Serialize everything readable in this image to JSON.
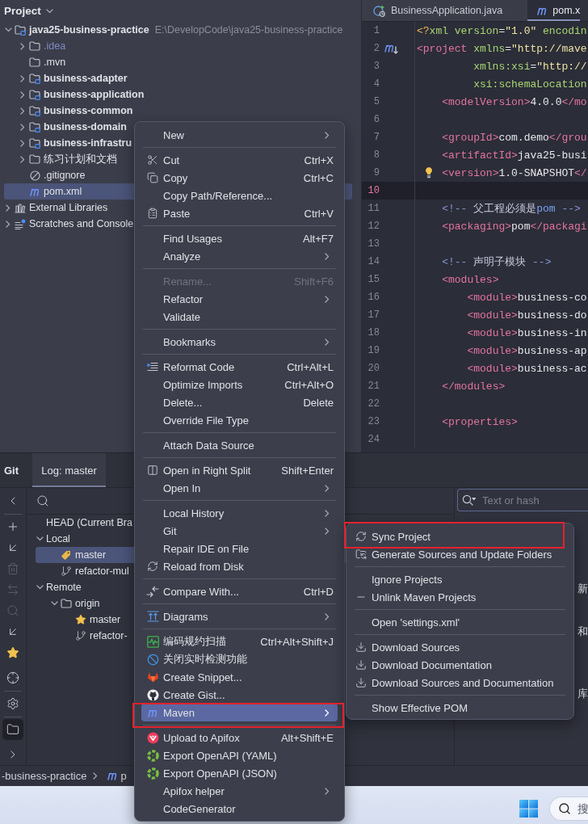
{
  "project_panel": {
    "title": "Project",
    "tree": [
      {
        "label": "java25-business-practice",
        "path": "E:\\DevelopCode\\java25-business-practice",
        "kind": "module",
        "expanded": true,
        "selected": false,
        "children": [
          {
            "label": ".idea",
            "kind": "excluded-folder",
            "expanded": false,
            "selected": false
          },
          {
            "label": ".mvn",
            "kind": "folder",
            "selected": false
          },
          {
            "label": "business-adapter",
            "kind": "module",
            "expanded": false,
            "selected": false
          },
          {
            "label": "business-application",
            "kind": "module",
            "expanded": false,
            "selected": false
          },
          {
            "label": "business-common",
            "kind": "module",
            "expanded": false,
            "selected": false
          },
          {
            "label": "business-domain",
            "kind": "module",
            "expanded": false,
            "selected": false
          },
          {
            "label": "business-infrastru",
            "kind": "module",
            "expanded": false,
            "selected": false
          },
          {
            "label": "练习计划和文档",
            "kind": "folder",
            "expanded": false,
            "selected": false
          },
          {
            "label": ".gitignore",
            "kind": "ignore-file",
            "selected": false
          },
          {
            "label": "pom.xml",
            "kind": "maven-file",
            "selected": true
          }
        ]
      },
      {
        "label": "External Libraries",
        "kind": "libraries",
        "expanded": false,
        "selected": false
      },
      {
        "label": "Scratches and Console",
        "kind": "scratches",
        "expanded": false,
        "selected": false
      }
    ]
  },
  "editor": {
    "tabs": [
      {
        "label": "BusinessApplication.java",
        "kind": "java",
        "selected": false
      },
      {
        "label": "pom.x",
        "kind": "maven",
        "selected": true
      }
    ],
    "lines": [
      {
        "number": "1",
        "current": false,
        "tokens": [
          {
            "kind": "pi",
            "text": "<?"
          },
          {
            "kind": "attr",
            "text": "xml version"
          },
          {
            "kind": "punct",
            "text": "="
          },
          {
            "kind": "value",
            "text": "\"1.0\""
          },
          {
            "kind": "attr",
            "text": " encodin"
          }
        ]
      },
      {
        "number": "2",
        "current": false,
        "tokens": [
          {
            "kind": "tag",
            "text": "<project"
          },
          {
            "kind": "attr",
            "text": " xmlns"
          },
          {
            "kind": "punct",
            "text": "="
          },
          {
            "kind": "value",
            "text": "\"http://mave"
          }
        ]
      },
      {
        "number": "3",
        "current": false,
        "tokens": [
          {
            "kind": "attr",
            "text": "         xmlns:xsi"
          },
          {
            "kind": "punct",
            "text": "="
          },
          {
            "kind": "value",
            "text": "\"http://"
          }
        ]
      },
      {
        "number": "4",
        "current": false,
        "tokens": [
          {
            "kind": "attr",
            "text": "         xsi:schemaLocation"
          }
        ]
      },
      {
        "number": "5",
        "current": false,
        "tokens": [
          {
            "kind": "tag",
            "text": "    <modelVersion>"
          },
          {
            "kind": "text",
            "text": "4.0.0"
          },
          {
            "kind": "tag",
            "text": "</mo"
          }
        ]
      },
      {
        "number": "6",
        "current": false
      },
      {
        "number": "7",
        "current": false,
        "tokens": [
          {
            "kind": "tag",
            "text": "    <groupId>"
          },
          {
            "kind": "text",
            "text": "com.demo"
          },
          {
            "kind": "tag",
            "text": "</grou"
          }
        ]
      },
      {
        "number": "8",
        "current": false,
        "tokens": [
          {
            "kind": "tag",
            "text": "    <artifactId>"
          },
          {
            "kind": "text",
            "text": "java25-busi"
          }
        ]
      },
      {
        "number": "9",
        "current": false,
        "tokens": [
          {
            "kind": "tag",
            "text": "    <version>"
          },
          {
            "kind": "text",
            "text": "1.0-SNAPSHOT"
          },
          {
            "kind": "tag",
            "text": "</"
          }
        ]
      },
      {
        "number": "10",
        "current": true
      },
      {
        "number": "11",
        "current": false,
        "tokens": [
          {
            "kind": "comment",
            "text": "    <!-- "
          },
          {
            "kind": "comment-text",
            "text": "父工程必须是"
          },
          {
            "kind": "comment-keyword",
            "text": "pom"
          },
          {
            "kind": "comment",
            "text": " -->"
          }
        ]
      },
      {
        "number": "12",
        "current": false,
        "tokens": [
          {
            "kind": "tag",
            "text": "    <packaging>"
          },
          {
            "kind": "text",
            "text": "pom"
          },
          {
            "kind": "tag",
            "text": "</packagi"
          }
        ]
      },
      {
        "number": "13",
        "current": false
      },
      {
        "number": "14",
        "current": false,
        "tokens": [
          {
            "kind": "comment",
            "text": "    <!-- "
          },
          {
            "kind": "comment-text",
            "text": "声明子模块"
          },
          {
            "kind": "comment",
            "text": " -->"
          }
        ]
      },
      {
        "number": "15",
        "current": false,
        "tokens": [
          {
            "kind": "tag",
            "text": "    <modules>"
          }
        ]
      },
      {
        "number": "16",
        "current": false,
        "tokens": [
          {
            "kind": "tag",
            "text": "        <module>"
          },
          {
            "kind": "text",
            "text": "business-co"
          }
        ]
      },
      {
        "number": "17",
        "current": false,
        "tokens": [
          {
            "kind": "tag",
            "text": "        <module>"
          },
          {
            "kind": "text",
            "text": "business-do"
          }
        ]
      },
      {
        "number": "18",
        "current": false,
        "tokens": [
          {
            "kind": "tag",
            "text": "        <module>"
          },
          {
            "kind": "text",
            "text": "business-in"
          }
        ]
      },
      {
        "number": "19",
        "current": false,
        "tokens": [
          {
            "kind": "tag",
            "text": "        <module>"
          },
          {
            "kind": "text",
            "text": "business-ap"
          }
        ]
      },
      {
        "number": "20",
        "current": false,
        "tokens": [
          {
            "kind": "tag",
            "text": "        <module>"
          },
          {
            "kind": "text",
            "text": "business-ac"
          }
        ]
      },
      {
        "number": "21",
        "current": false,
        "tokens": [
          {
            "kind": "tag",
            "text": "    </modules>"
          }
        ]
      },
      {
        "number": "22",
        "current": false
      },
      {
        "number": "23",
        "current": false,
        "tokens": [
          {
            "kind": "tag",
            "text": "    <properties>"
          }
        ]
      },
      {
        "number": "24",
        "current": false
      }
    ]
  },
  "git_panel": {
    "title": "Git",
    "tabs": [
      {
        "label": "Log: master",
        "selected": true
      }
    ],
    "toolbar": [
      [
        {
          "kind": "collapse",
          "disabled": false,
          "selected": false
        }
      ],
      [
        {
          "kind": "add",
          "disabled": false,
          "selected": false
        },
        {
          "kind": "checkout",
          "disabled": false,
          "selected": false
        },
        {
          "kind": "delete",
          "disabled": true,
          "selected": false
        },
        {
          "kind": "compare",
          "disabled": true,
          "selected": false
        },
        {
          "kind": "search",
          "disabled": true,
          "selected": false
        },
        {
          "kind": "update",
          "disabled": false,
          "selected": false
        },
        {
          "kind": "favorite",
          "disabled": false,
          "selected": false
        },
        {
          "kind": "locate",
          "disabled": false,
          "selected": false
        }
      ],
      [
        {
          "kind": "settings",
          "disabled": false,
          "selected": false
        }
      ],
      [
        {
          "kind": "branches",
          "disabled": false,
          "selected": true
        },
        {
          "kind": "expand",
          "disabled": false,
          "selected": false
        }
      ]
    ],
    "branches": [
      {
        "label": "HEAD (Current Bra",
        "selected": false
      },
      {
        "label": "Local",
        "expanded": true,
        "selected": false,
        "children": [
          {
            "label": "master",
            "kind": "current-branch",
            "selected": true
          },
          {
            "label": "refactor-mul",
            "kind": "branch",
            "selected": false
          }
        ]
      },
      {
        "label": "Remote",
        "expanded": true,
        "selected": false,
        "children": [
          {
            "label": "origin",
            "kind": "remote",
            "expanded": true,
            "selected": false,
            "children": [
              {
                "label": "master",
                "kind": "favorite-branch",
                "selected": false
              },
              {
                "label": "refactor-",
                "kind": "branch",
                "selected": false
              }
            ]
          }
        ]
      }
    ],
    "log_search": {
      "placeholder": "Text or hash"
    },
    "log_fragments": [
      "新",
      "和",
      "库"
    ]
  },
  "context_menu": {
    "sections": [
      [
        {
          "label": "New",
          "submenu": true,
          "disabled": false,
          "selected": false
        }
      ],
      [
        {
          "label": "Cut",
          "shortcut": "Ctrl+X",
          "submenu": false,
          "disabled": false,
          "selected": false
        },
        {
          "label": "Copy",
          "shortcut": "Ctrl+C",
          "submenu": false,
          "disabled": false,
          "selected": false
        },
        {
          "label": "Copy Path/Reference...",
          "submenu": false,
          "disabled": false,
          "selected": false
        },
        {
          "label": "Paste",
          "shortcut": "Ctrl+V",
          "submenu": false,
          "disabled": false,
          "selected": false
        }
      ],
      [
        {
          "label": "Find Usages",
          "shortcut": "Alt+F7",
          "submenu": false,
          "disabled": false,
          "selected": false
        },
        {
          "label": "Analyze",
          "submenu": true,
          "disabled": false,
          "selected": false
        }
      ],
      [
        {
          "label": "Rename...",
          "shortcut": "Shift+F6",
          "submenu": false,
          "disabled": true,
          "selected": false
        },
        {
          "label": "Refactor",
          "submenu": true,
          "disabled": false,
          "selected": false
        },
        {
          "label": "Validate",
          "submenu": false,
          "disabled": false,
          "selected": false
        }
      ],
      [
        {
          "label": "Bookmarks",
          "submenu": true,
          "disabled": false,
          "selected": false
        }
      ],
      [
        {
          "label": "Reformat Code",
          "shortcut": "Ctrl+Alt+L",
          "submenu": false,
          "disabled": false,
          "selected": false
        },
        {
          "label": "Optimize Imports",
          "shortcut": "Ctrl+Alt+O",
          "submenu": false,
          "disabled": false,
          "selected": false
        },
        {
          "label": "Delete...",
          "shortcut": "Delete",
          "submenu": false,
          "disabled": false,
          "selected": false
        },
        {
          "label": "Override File Type",
          "submenu": false,
          "disabled": false,
          "selected": false
        }
      ],
      [
        {
          "label": "Attach Data Source",
          "submenu": false,
          "disabled": false,
          "selected": false
        }
      ],
      [
        {
          "label": "Open in Right Split",
          "shortcut": "Shift+Enter",
          "submenu": false,
          "disabled": false,
          "selected": false
        },
        {
          "label": "Open In",
          "submenu": true,
          "disabled": false,
          "selected": false
        }
      ],
      [
        {
          "label": "Local History",
          "submenu": true,
          "disabled": false,
          "selected": false
        },
        {
          "label": "Git",
          "submenu": true,
          "disabled": false,
          "selected": false
        },
        {
          "label": "Repair IDE on File",
          "submenu": false,
          "disabled": false,
          "selected": false
        },
        {
          "label": "Reload from Disk",
          "submenu": false,
          "disabled": false,
          "selected": false
        }
      ],
      [
        {
          "label": "Compare With...",
          "shortcut": "Ctrl+D",
          "submenu": false,
          "disabled": false,
          "selected": false
        }
      ],
      [
        {
          "label": "Diagrams",
          "submenu": true,
          "disabled": false,
          "selected": false
        }
      ],
      [
        {
          "label": "编码规约扫描",
          "shortcut": "Ctrl+Alt+Shift+J",
          "submenu": false,
          "disabled": false,
          "selected": false
        },
        {
          "label": "关闭实时检测功能",
          "submenu": false,
          "disabled": false,
          "selected": false
        },
        {
          "label": "Create Snippet...",
          "submenu": false,
          "disabled": false,
          "selected": false
        },
        {
          "label": "Create Gist...",
          "submenu": false,
          "disabled": false,
          "selected": false
        },
        {
          "label": "Maven",
          "submenu": true,
          "disabled": false,
          "selected": true
        }
      ],
      [
        {
          "label": "Upload to Apifox",
          "shortcut": "Alt+Shift+E",
          "submenu": false,
          "disabled": false,
          "selected": false
        },
        {
          "label": "Export OpenAPI (YAML)",
          "submenu": false,
          "disabled": false,
          "selected": false
        },
        {
          "label": "Export OpenAPI (JSON)",
          "submenu": false,
          "disabled": false,
          "selected": false
        },
        {
          "label": "Apifox helper",
          "submenu": true,
          "disabled": false,
          "selected": false
        },
        {
          "label": "CodeGenerator",
          "submenu": false,
          "disabled": false,
          "selected": false
        }
      ]
    ]
  },
  "maven_submenu": {
    "sections": [
      [
        {
          "label": "Sync Project",
          "submenu": false,
          "disabled": false,
          "selected": false
        },
        {
          "label": "Generate Sources and Update Folders",
          "submenu": false,
          "disabled": false,
          "selected": false
        }
      ],
      [
        {
          "label": "Ignore Projects",
          "submenu": false,
          "disabled": false,
          "selected": false
        },
        {
          "label": "Unlink Maven Projects",
          "submenu": false,
          "disabled": false,
          "selected": false
        }
      ],
      [
        {
          "label": "Open 'settings.xml'",
          "submenu": false,
          "disabled": false,
          "selected": false
        }
      ],
      [
        {
          "label": "Download Sources",
          "submenu": false,
          "disabled": false,
          "selected": false
        },
        {
          "label": "Download Documentation",
          "submenu": false,
          "disabled": false,
          "selected": false
        },
        {
          "label": "Download Sources and Documentation",
          "submenu": false,
          "disabled": false,
          "selected": false
        }
      ],
      [
        {
          "label": "Show Effective POM",
          "submenu": false,
          "disabled": false,
          "selected": false
        }
      ]
    ]
  },
  "status_bar": {
    "breadcrumbs": [
      {
        "label": "-business-practice",
        "kind": "folder"
      },
      {
        "label": "p",
        "kind": "maven"
      }
    ]
  },
  "taskbar": {
    "search": {
      "placeholder": "搜"
    }
  }
}
